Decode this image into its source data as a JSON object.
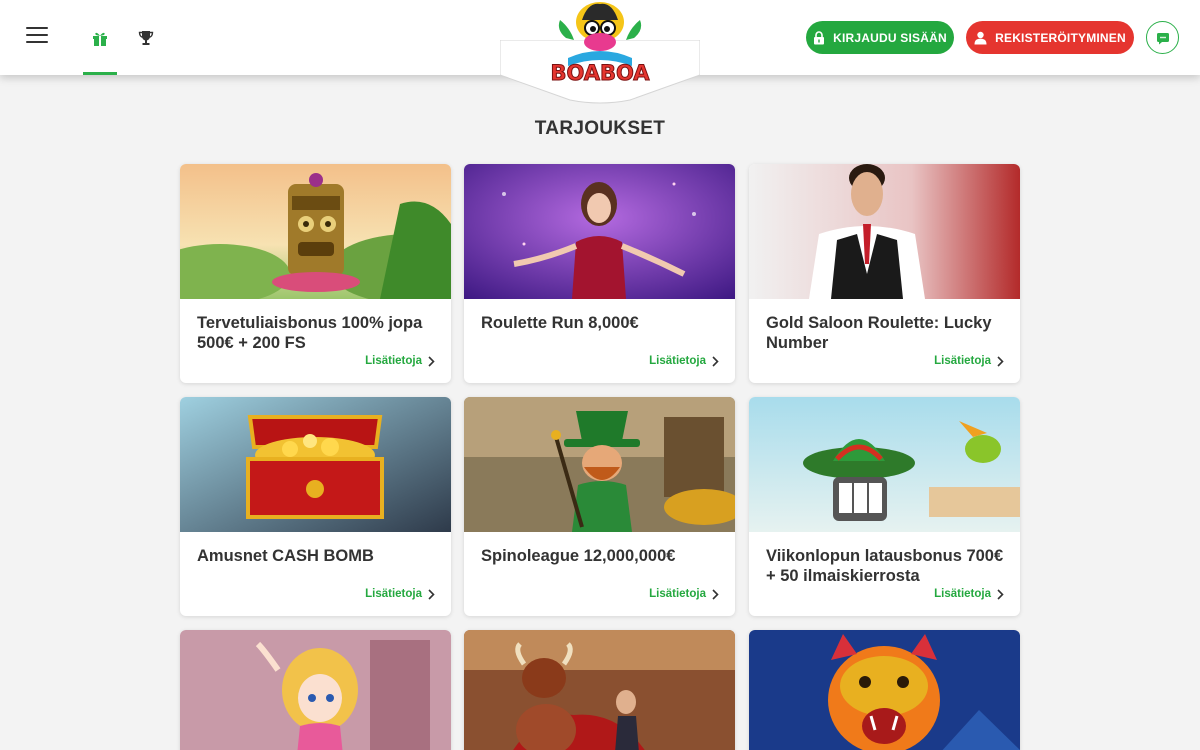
{
  "header": {
    "menu_icon": "hamburger-icon",
    "nav": [
      {
        "icon": "gift-icon",
        "active": true
      },
      {
        "icon": "trophy-icon",
        "active": false
      }
    ],
    "logo_text": "BOABOA",
    "login_label": "KIRJAUDU SISÄÄN",
    "register_label": "REKISTERÖITYMINEN",
    "chat_icon": "chat-icon"
  },
  "colors": {
    "accent_green": "#24a83f",
    "accent_red": "#e5352f",
    "background": "#f3f3f3"
  },
  "page": {
    "title": "TARJOUKSET"
  },
  "promotions": [
    {
      "title": "Tervetuliaisbonus 100% jopa 500€ + 200 FS",
      "link": "Lisätietoja"
    },
    {
      "title": "Roulette Run 8,000€",
      "link": "Lisätietoja"
    },
    {
      "title": "Gold Saloon Roulette: Lucky Number",
      "link": "Lisätietoja"
    },
    {
      "title": "Amusnet CASH BOMB",
      "link": "Lisätietoja"
    },
    {
      "title": "Spinoleague 12,000,000€",
      "link": "Lisätietoja"
    },
    {
      "title": "Viikonlopun latausbonus 700€ + 50 ilmaiskierrosta",
      "link": "Lisätietoja"
    }
  ]
}
